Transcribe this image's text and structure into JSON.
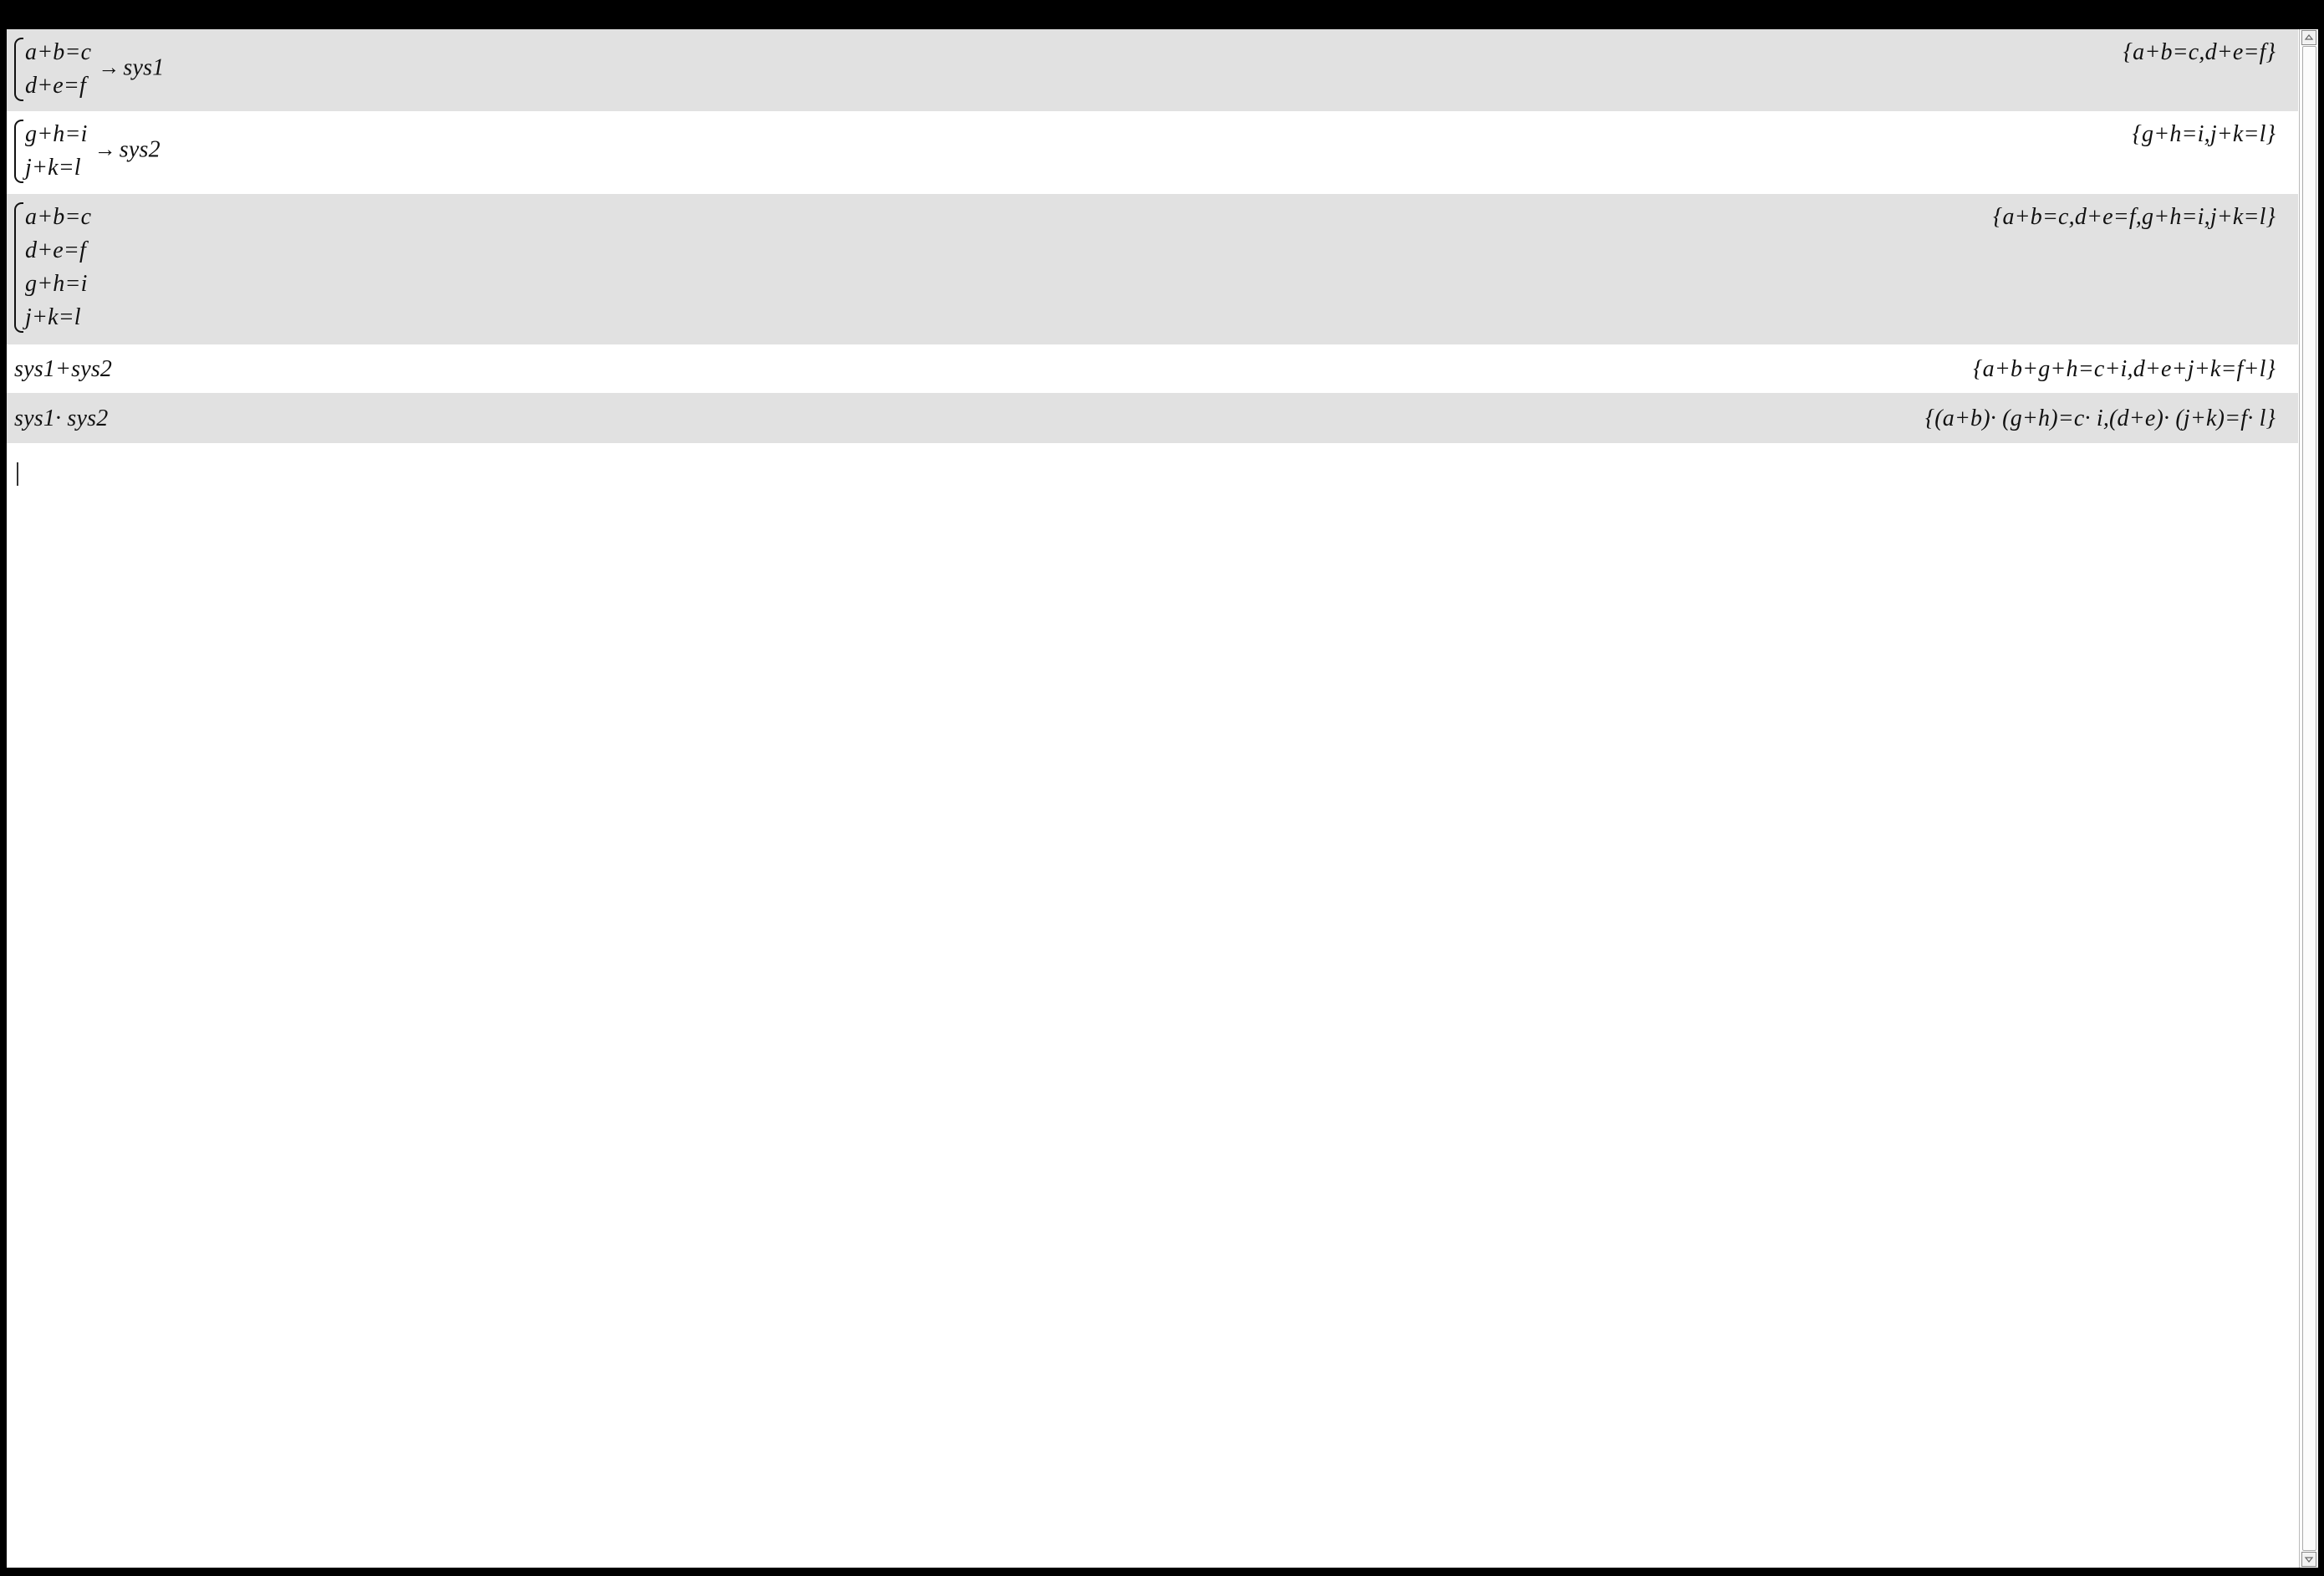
{
  "rows": [
    {
      "input_lines": [
        "a+b=c",
        "d+e=f"
      ],
      "input_arrow": "→",
      "input_target": "sys1",
      "output": "{a+b=c,d+e=f}"
    },
    {
      "input_lines": [
        "g+h=i",
        "j+k=l"
      ],
      "input_arrow": "→",
      "input_target": "sys2",
      "output": "{g+h=i,j+k=l}"
    },
    {
      "input_lines": [
        "a+b=c",
        "d+e=f",
        "g+h=i",
        "j+k=l"
      ],
      "output": "{a+b=c,d+e=f,g+h=i,j+k=l}"
    },
    {
      "input": "sys1+sys2",
      "output": "{a+b+g+h=c+i,d+e+j+k=f+l}"
    },
    {
      "input": "sys1· sys2",
      "output": "{(a+b)· (g+h)=c· i,(d+e)· (j+k)=f· l}"
    }
  ],
  "icons": {
    "scroll_up": "arrow-up-icon",
    "scroll_down": "arrow-down-icon"
  },
  "colors": {
    "shaded_row": "#e1e1e1",
    "plain_row": "#ffffff",
    "frame": "#000000"
  }
}
